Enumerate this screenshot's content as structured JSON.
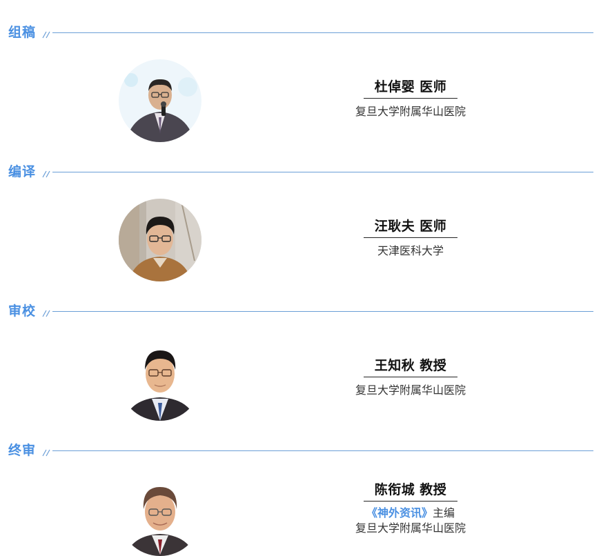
{
  "sections": [
    {
      "title": "组稿",
      "person": {
        "name": "杜倬婴  医师",
        "affiliation": "复旦大学附属华山医院"
      }
    },
    {
      "title": "编译",
      "person": {
        "name": "汪耿夫  医师",
        "affiliation": "天津医科大学"
      }
    },
    {
      "title": "审校",
      "person": {
        "name": "王知秋  教授",
        "affiliation": "复旦大学附属华山医院"
      }
    },
    {
      "title": "终审",
      "person": {
        "name": "陈衔城  教授",
        "journal": "《神外资讯》",
        "role": "主编",
        "affiliation": "复旦大学附属华山医院"
      }
    }
  ],
  "colors": {
    "accent": "#4a90e2",
    "divider": "#6a9ed6"
  },
  "icons": [
    "double-slash-icon",
    "avatar-photo"
  ]
}
